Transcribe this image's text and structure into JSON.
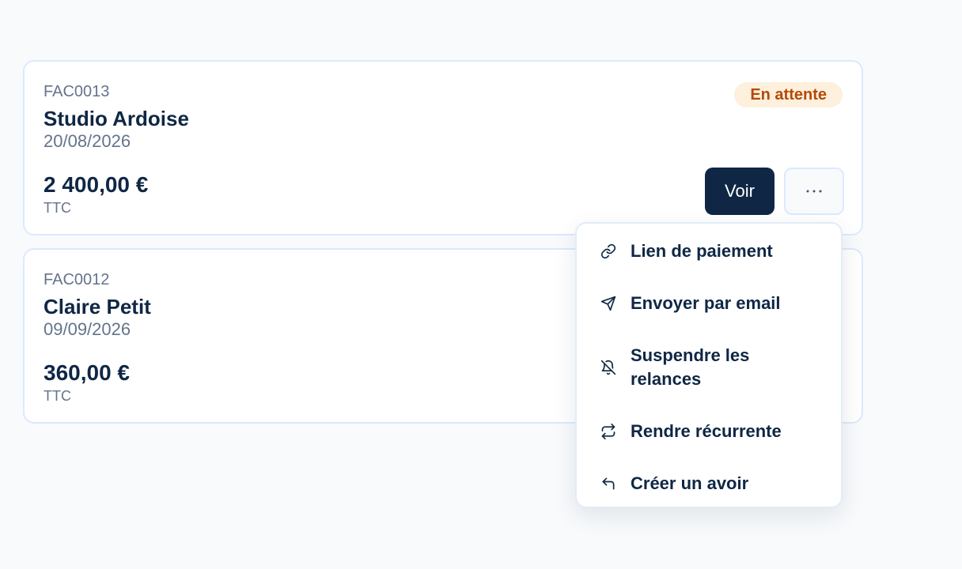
{
  "invoices": [
    {
      "number": "FAC0013",
      "client": "Studio Ardoise",
      "date": "20/08/2026",
      "amount": "2 400,00 €",
      "tax_label": "TTC",
      "status": "En attente"
    },
    {
      "number": "FAC0012",
      "client": "Claire Petit",
      "date": "09/09/2026",
      "amount": "360,00 €",
      "tax_label": "TTC"
    }
  ],
  "actions": {
    "view_label": "Voir",
    "more_label": "···"
  },
  "menu": {
    "items": [
      {
        "label": "Lien de paiement",
        "icon": "link-icon"
      },
      {
        "label": "Envoyer par email",
        "icon": "send-icon"
      },
      {
        "label": "Suspendre les relances",
        "icon": "bell-off-icon"
      },
      {
        "label": "Rendre récurrente",
        "icon": "repeat-icon"
      },
      {
        "label": "Créer un avoir",
        "icon": "undo-icon"
      }
    ]
  },
  "colors": {
    "primary": "#0f2744",
    "muted": "#64748b",
    "border": "#dbeafe",
    "badge_bg": "#fdf0dc",
    "badge_text": "#b44a0a"
  }
}
